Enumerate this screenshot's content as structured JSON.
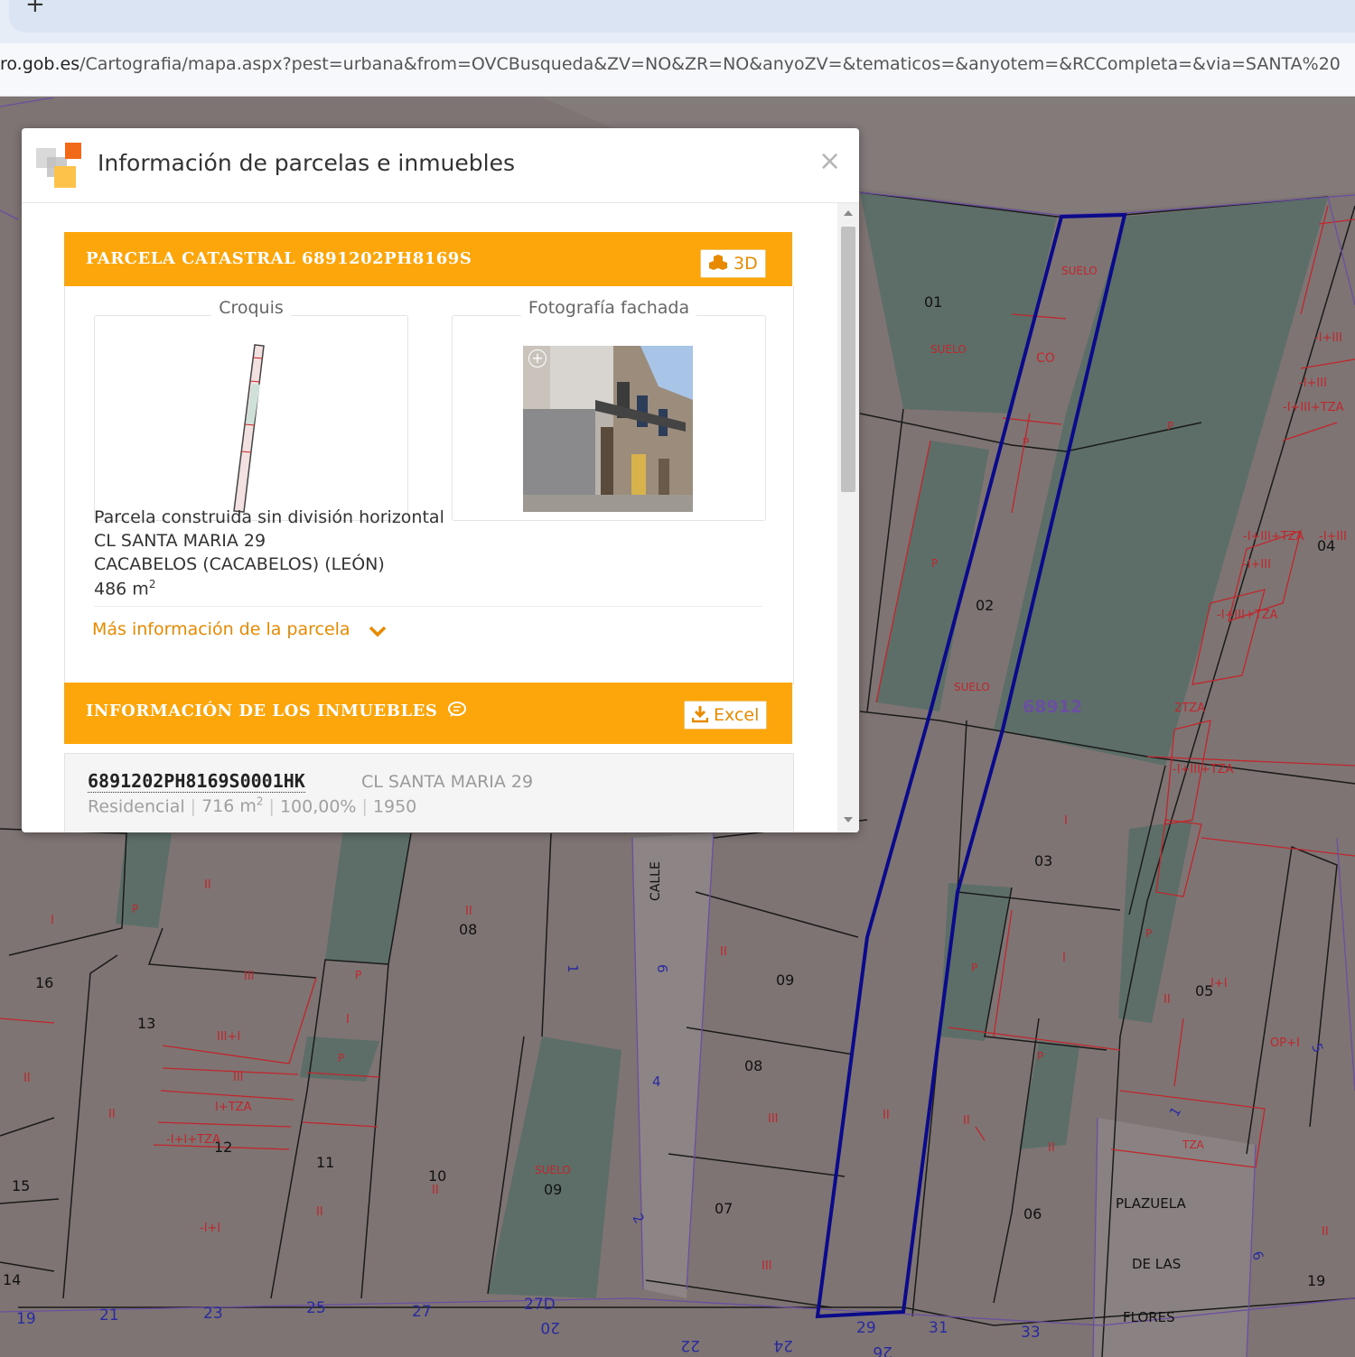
{
  "browser": {
    "new_tab_label": "+",
    "url_host": "ro.gob.es",
    "url_rest": "/Cartografia/mapa.aspx?pest=urbana&from=OVCBusqueda&ZV=NO&ZR=NO&anyoZV=&tematicos=&anyotem=&RCCompleta=&via=SANTA%20"
  },
  "dialog": {
    "title": "Información de parcelas e inmuebles",
    "close_label": "×",
    "parcel": {
      "header": "PARCELA CATASTRAL 6891202PH8169S",
      "btn_3d": "3D",
      "croquis_label": "Croquis",
      "fachada_label": "Fotografía fachada",
      "type": "Parcela construida sin división horizontal",
      "address": "CL SANTA MARIA 29",
      "municipality": "CACABELOS (CACABELOS) (LEÓN)",
      "surface_value": "486 m",
      "surface_sup": "2",
      "more_info": "Más información de la parcela"
    },
    "inmuebles": {
      "header": "INFORMACIÓN DE LOS INMUEBLES",
      "btn_excel": "Excel",
      "rows": [
        {
          "ref": "6891202PH8169S0001HK",
          "address": "CL SANTA MARIA 29",
          "use": "Residencial",
          "surface": "716 m",
          "surface_sup": "2",
          "share": "100,00%",
          "year": "1950"
        }
      ]
    }
  },
  "map": {
    "colors": {
      "built": "#7e7474",
      "unbuilt": "#5d6e68",
      "selected": "#0a0a8a",
      "red_lines": "#c0262b",
      "purple_lines": "#6a4fa0"
    },
    "labels": {
      "suelo": "SUELO",
      "co": "CO",
      "p": "P",
      "n01": "01",
      "n02": "02",
      "n03": "03",
      "n04": "04",
      "n05": "05",
      "n06": "06",
      "n07": "07",
      "n08": "08",
      "n09": "09",
      "n10": "10",
      "n11": "11",
      "n12": "12",
      "n13": "13",
      "n14": "14",
      "n15": "15",
      "n16": "16",
      "n19": "19",
      "block": "68912",
      "calle": "CALLE",
      "plazuela": "PLAZUELA",
      "delas": "DE LAS",
      "flores": "FLORES",
      "s19": "19",
      "s21": "21",
      "s23": "23",
      "s25": "25",
      "s27": "27",
      "s27d": "27D",
      "s29": "29",
      "s31": "31",
      "s33": "33",
      "s20": "20",
      "s22": "22",
      "s24": "24",
      "s26": "26",
      "lII": "II",
      "lI": "I",
      "lIII": "III",
      "lIIIpI": "III+I",
      "lItza": "I+TZA",
      "lIpItza": "-I+I+TZA",
      "lIpI": "-I+I",
      "lIIItza": "-I+III+TZA",
      "l2tza": "2TZA",
      "lIpIII": "-I+III",
      "lsuelo2": "SUELO",
      "ltza": "TZA",
      "lIpIIItza2": "-I+III+TZA",
      "lIpI2": "I+I",
      "lIII2": "-I+III",
      "lopI": "OP+I",
      "b1": "1",
      "b4": "4",
      "b6": "6",
      "b2": "2",
      "b5": "5",
      "b9": "6"
    }
  }
}
